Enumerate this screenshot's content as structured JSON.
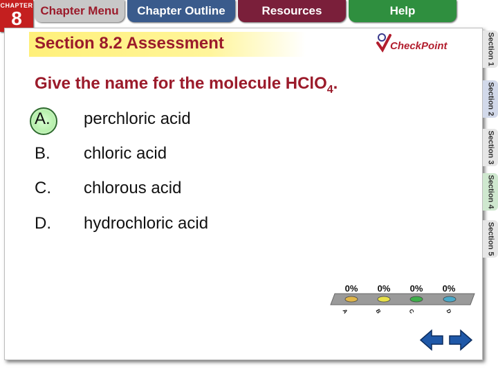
{
  "nav": {
    "chapter_label": "CHAPTER",
    "chapter_number": "8",
    "tabs": [
      "Chapter Menu",
      "Chapter Outline",
      "Resources",
      "Help"
    ]
  },
  "slide": {
    "title": "Section 8.2 Assessment",
    "logo_text": "CheckPoint",
    "question_prefix": "Give the name for the molecule HClO",
    "question_subscript": "4",
    "question_suffix": ".",
    "answers": [
      {
        "letter": "A.",
        "text": "perchloric acid"
      },
      {
        "letter": "B.",
        "text": "chloric acid"
      },
      {
        "letter": "C.",
        "text": "chlorous acid"
      },
      {
        "letter": "D.",
        "text": "hydrochloric acid"
      }
    ],
    "selected_answer": "A."
  },
  "side_tabs": [
    "Section 1",
    "Section 2",
    "Section 3",
    "Section 4",
    "Section 5"
  ],
  "side_tab_colors": [
    "#e6e6e6",
    "#d2d9ea",
    "#e6e6e6",
    "#cfe8cf",
    "#e6e6e6"
  ],
  "chart_data": {
    "type": "bar",
    "categories": [
      "A",
      "B",
      "C",
      "D"
    ],
    "values": [
      0,
      0,
      0,
      0
    ],
    "value_labels": [
      "0%",
      "0%",
      "0%",
      "0%"
    ],
    "colors": [
      "#e0b64a",
      "#e8e14a",
      "#3fae4a",
      "#4aa9c9"
    ],
    "ylim": [
      0,
      100
    ]
  }
}
